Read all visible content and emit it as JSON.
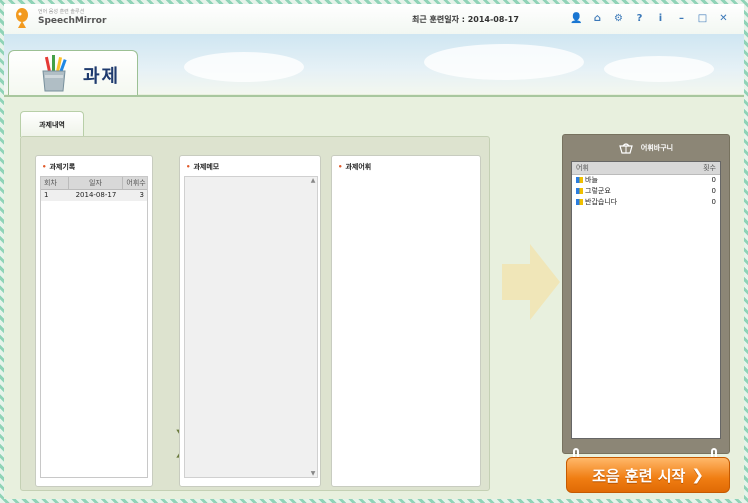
{
  "app": {
    "subtitle": "언어 음성 훈련 솔루션",
    "name": "SpeechMirror",
    "recent_training": "최근 훈련일자 : 2014-08-17"
  },
  "toolbar": {
    "icons": [
      "user-icon",
      "home-icon",
      "gear-icon",
      "help-icon",
      "info-icon",
      "minimize-icon",
      "maximize-icon",
      "close-icon"
    ],
    "glyphs": [
      "👤",
      "⌂",
      "⚙",
      "?",
      "i",
      "–",
      "□",
      "✕"
    ]
  },
  "section": {
    "title": "과제"
  },
  "subtab": {
    "label": "과제내역"
  },
  "history": {
    "title": "과제기록",
    "columns": [
      "회차",
      "일자",
      "어휘수"
    ],
    "rows": [
      {
        "round": "1",
        "date": "2014-08-17",
        "count": "3"
      }
    ]
  },
  "memo": {
    "title": "과제메모"
  },
  "vocab": {
    "title": "과제어휘"
  },
  "basket": {
    "title": "어휘바구니",
    "columns": [
      "어휘",
      "횟수"
    ],
    "rows": [
      {
        "word": "바늘",
        "count": "0"
      },
      {
        "word": "그렇군요",
        "count": "0"
      },
      {
        "word": "반갑습니다",
        "count": "0"
      }
    ]
  },
  "start_button": {
    "label": "조음 훈련 시작",
    "arrow": "❯"
  },
  "colors": {
    "accent": "#f07d12",
    "panel": "#dde3cf",
    "basket": "#8c8676"
  }
}
